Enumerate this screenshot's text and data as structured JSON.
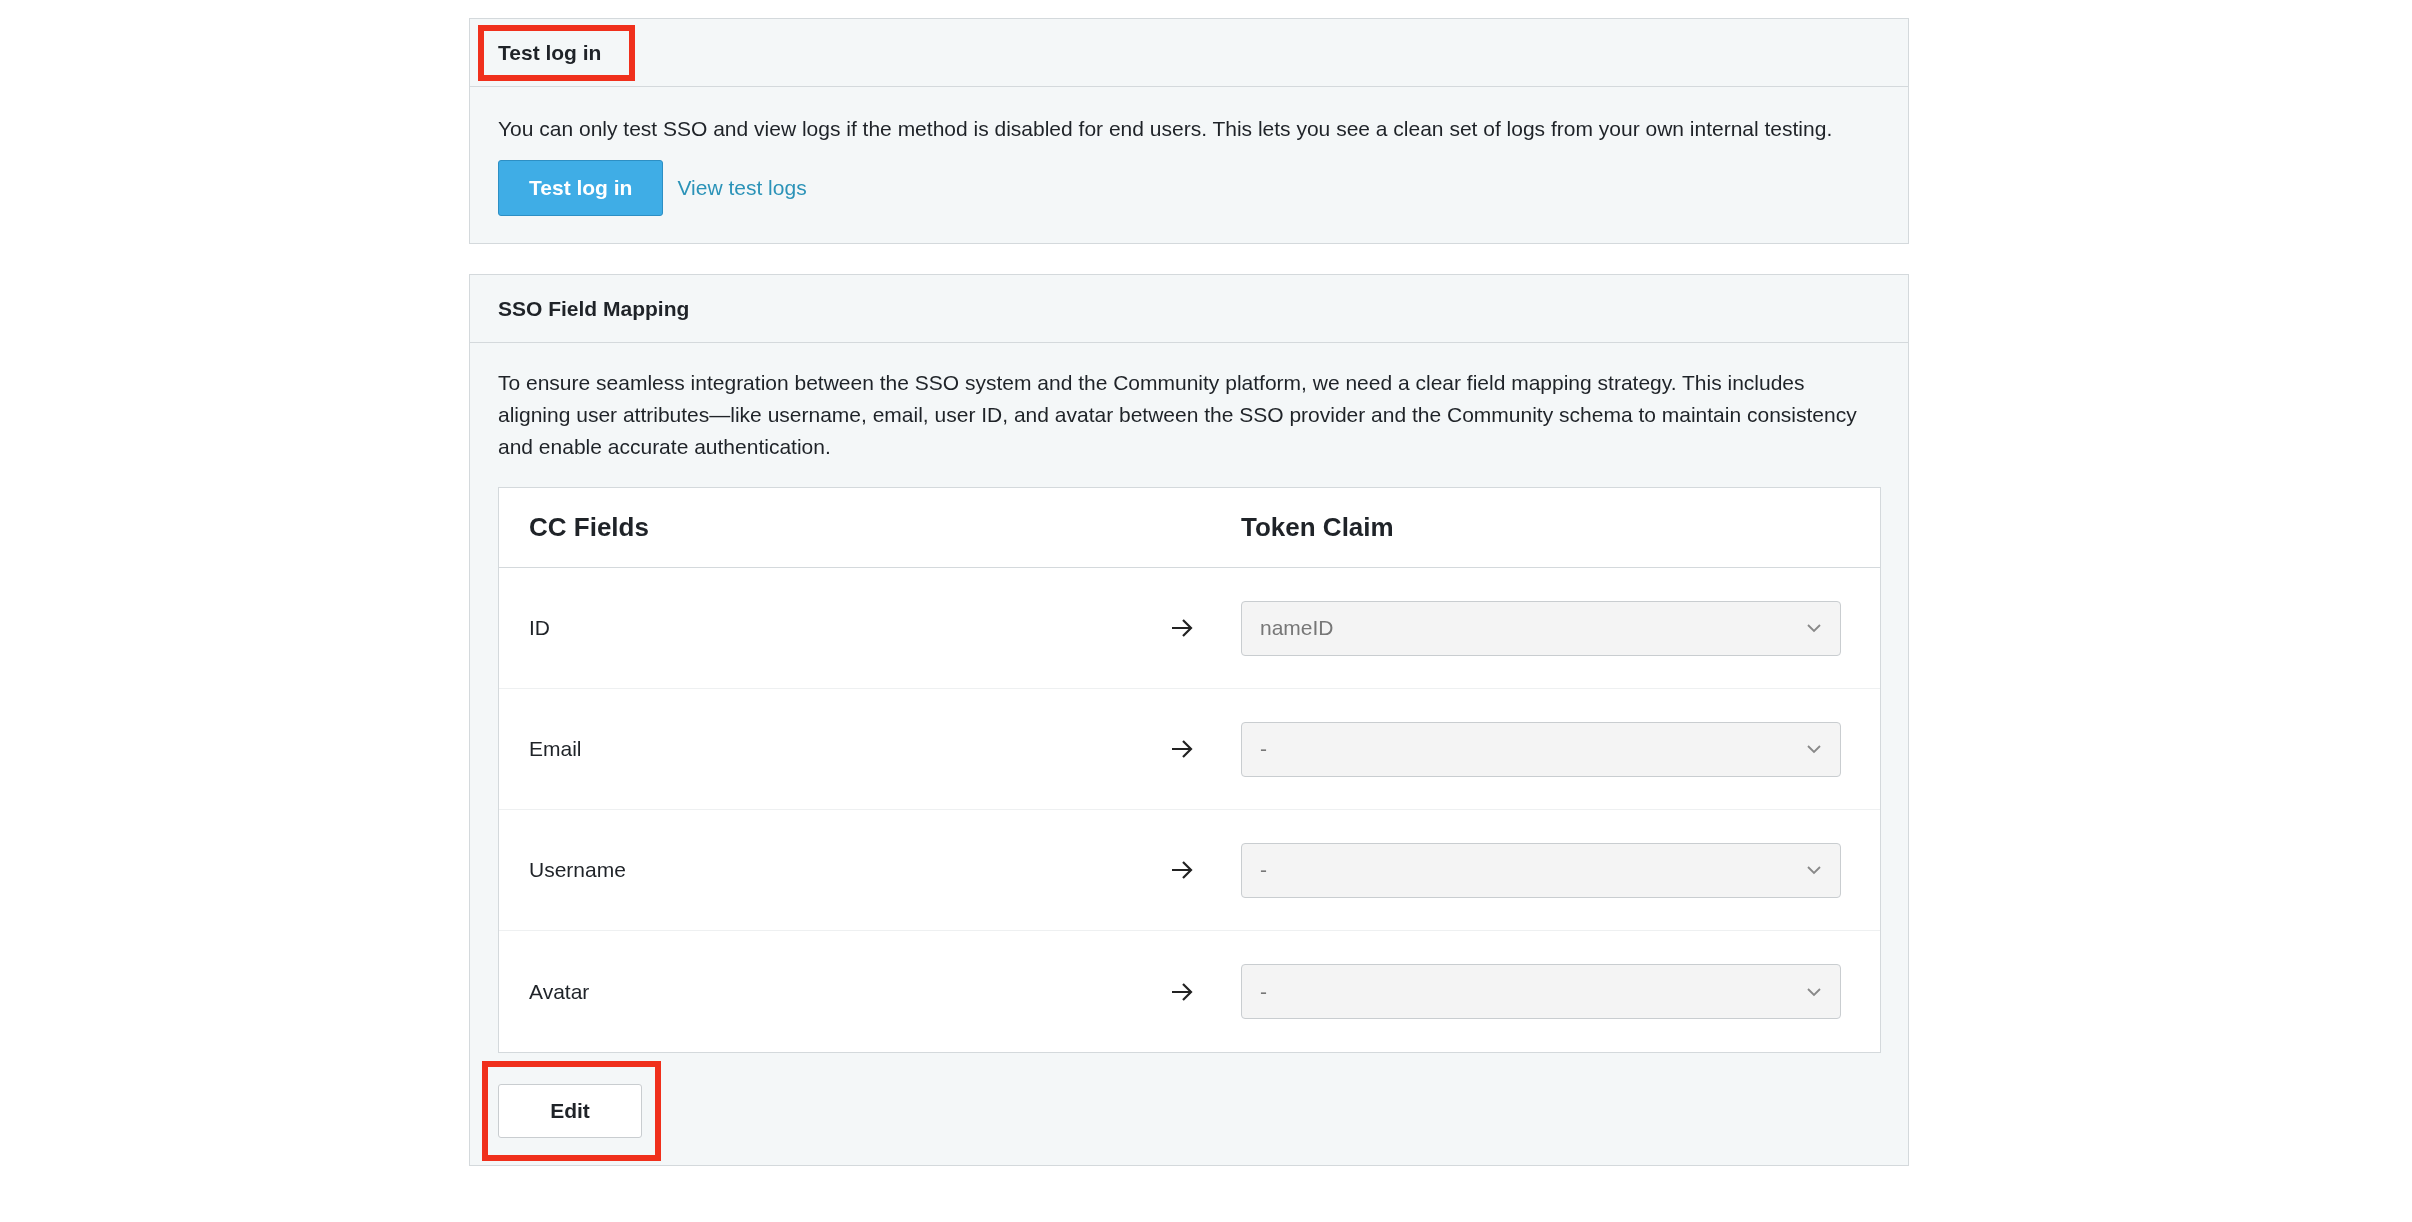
{
  "test_panel": {
    "title": "Test log in",
    "title_highlighted": true,
    "description": "You can only test SSO and view logs if the method is disabled for end users. This lets you see a clean set of logs from your own internal testing.",
    "primary_button": "Test log in",
    "link": "View test logs"
  },
  "mapping_panel": {
    "title": "SSO Field Mapping",
    "description": "To ensure seamless integration between the SSO system and the Community platform, we need a clear field mapping strategy. This includes aligning user attributes—like username, email, user ID, and avatar between the SSO provider and the Community schema to maintain consistency and enable accurate authentication.",
    "table": {
      "columns": [
        "CC Fields",
        "Token Claim"
      ],
      "rows": [
        {
          "field": "ID",
          "claim": "nameID"
        },
        {
          "field": "Email",
          "claim": "-"
        },
        {
          "field": "Username",
          "claim": "-"
        },
        {
          "field": "Avatar",
          "claim": "-"
        }
      ]
    },
    "edit_button": "Edit",
    "edit_highlighted": true
  }
}
